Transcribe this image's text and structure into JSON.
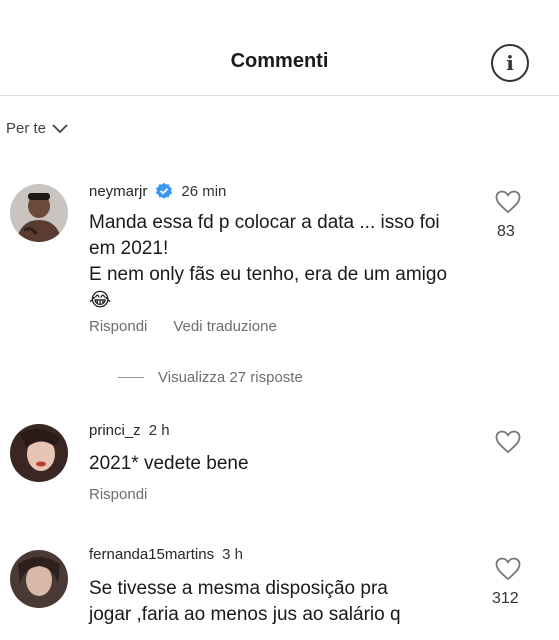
{
  "header": {
    "title": "Commenti",
    "info_icon": "info-icon"
  },
  "sort": {
    "label": "Per te",
    "icon": "chevron-down-icon"
  },
  "comments": [
    {
      "username": "neymarjr",
      "verified": true,
      "time": "26 min",
      "lines": [
        "Manda essa fd p colocar a data ... isso foi",
        "em 2021!",
        "E nem only fãs eu tenho, era de um amigo",
        "😂"
      ],
      "actions": [
        "Rispondi",
        "Vedi traduzione"
      ],
      "likes": "83"
    },
    {
      "username": "princi_z",
      "verified": false,
      "time": "2 h",
      "lines": [
        "2021* vedete bene"
      ],
      "actions": [
        "Rispondi"
      ],
      "likes": ""
    },
    {
      "username": "fernanda15martins",
      "verified": false,
      "time": "3 h",
      "lines": [
        "Se tivesse a mesma disposição pra",
        "jogar ,faria ao menos  jus ao salário q"
      ],
      "actions": [],
      "likes": "312"
    }
  ],
  "view_replies": "Visualizza 27 risposte",
  "colors": {
    "verified": "#3897f0",
    "muted": "#6d6d6d",
    "border": "#dbdbdb"
  }
}
